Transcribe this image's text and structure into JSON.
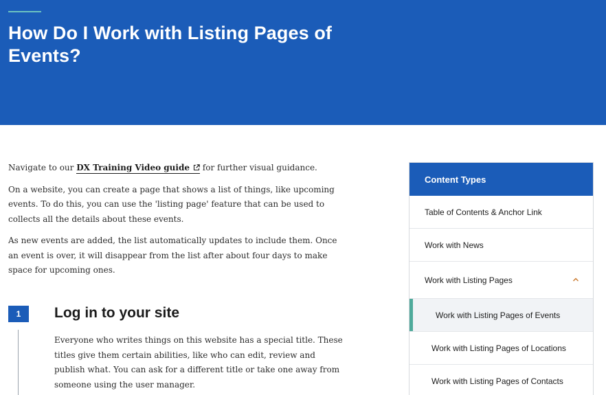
{
  "header": {
    "title": "How Do I Work with Listing Pages of Events?"
  },
  "intro": {
    "navigate_prefix": "Navigate to our ",
    "guide_link": "DX Training Video guide",
    "navigate_suffix": " for further visual guidance.",
    "para1": "On a website, you can create a page that shows a list of things, like upcoming events. To do this, you can use the 'listing page' feature that can be used to collects all the details about these events.",
    "para2": "As new events are added, the list automatically updates to include them. Once an event is over, it will disappear from the list after about four days to make space for upcoming ones."
  },
  "step1": {
    "number": "1",
    "heading": "Log in to your site",
    "body": "Everyone who writes things on this website has a special title. These titles give them certain abilities, like who can edit, review and publish what. You can ask for a different title or take one away from someone using the user manager."
  },
  "sidebar": {
    "header": "Content Types",
    "items": [
      {
        "label": "Table of Contents & Anchor Link"
      },
      {
        "label": "Work with News"
      },
      {
        "label": "Work with Listing Pages",
        "expanded": true
      },
      {
        "label": "Work with Listing Pages of Events",
        "active": true
      },
      {
        "label": "Work with Listing Pages of Locations"
      },
      {
        "label": "Work with Listing Pages of Contacts"
      }
    ]
  },
  "colors": {
    "brand_blue": "#1b5cb8",
    "accent_teal": "#4faa9b",
    "chevron_orange": "#c9772a"
  },
  "icons": {
    "external": "external-link-icon",
    "chevron": "chevron-up-icon"
  }
}
